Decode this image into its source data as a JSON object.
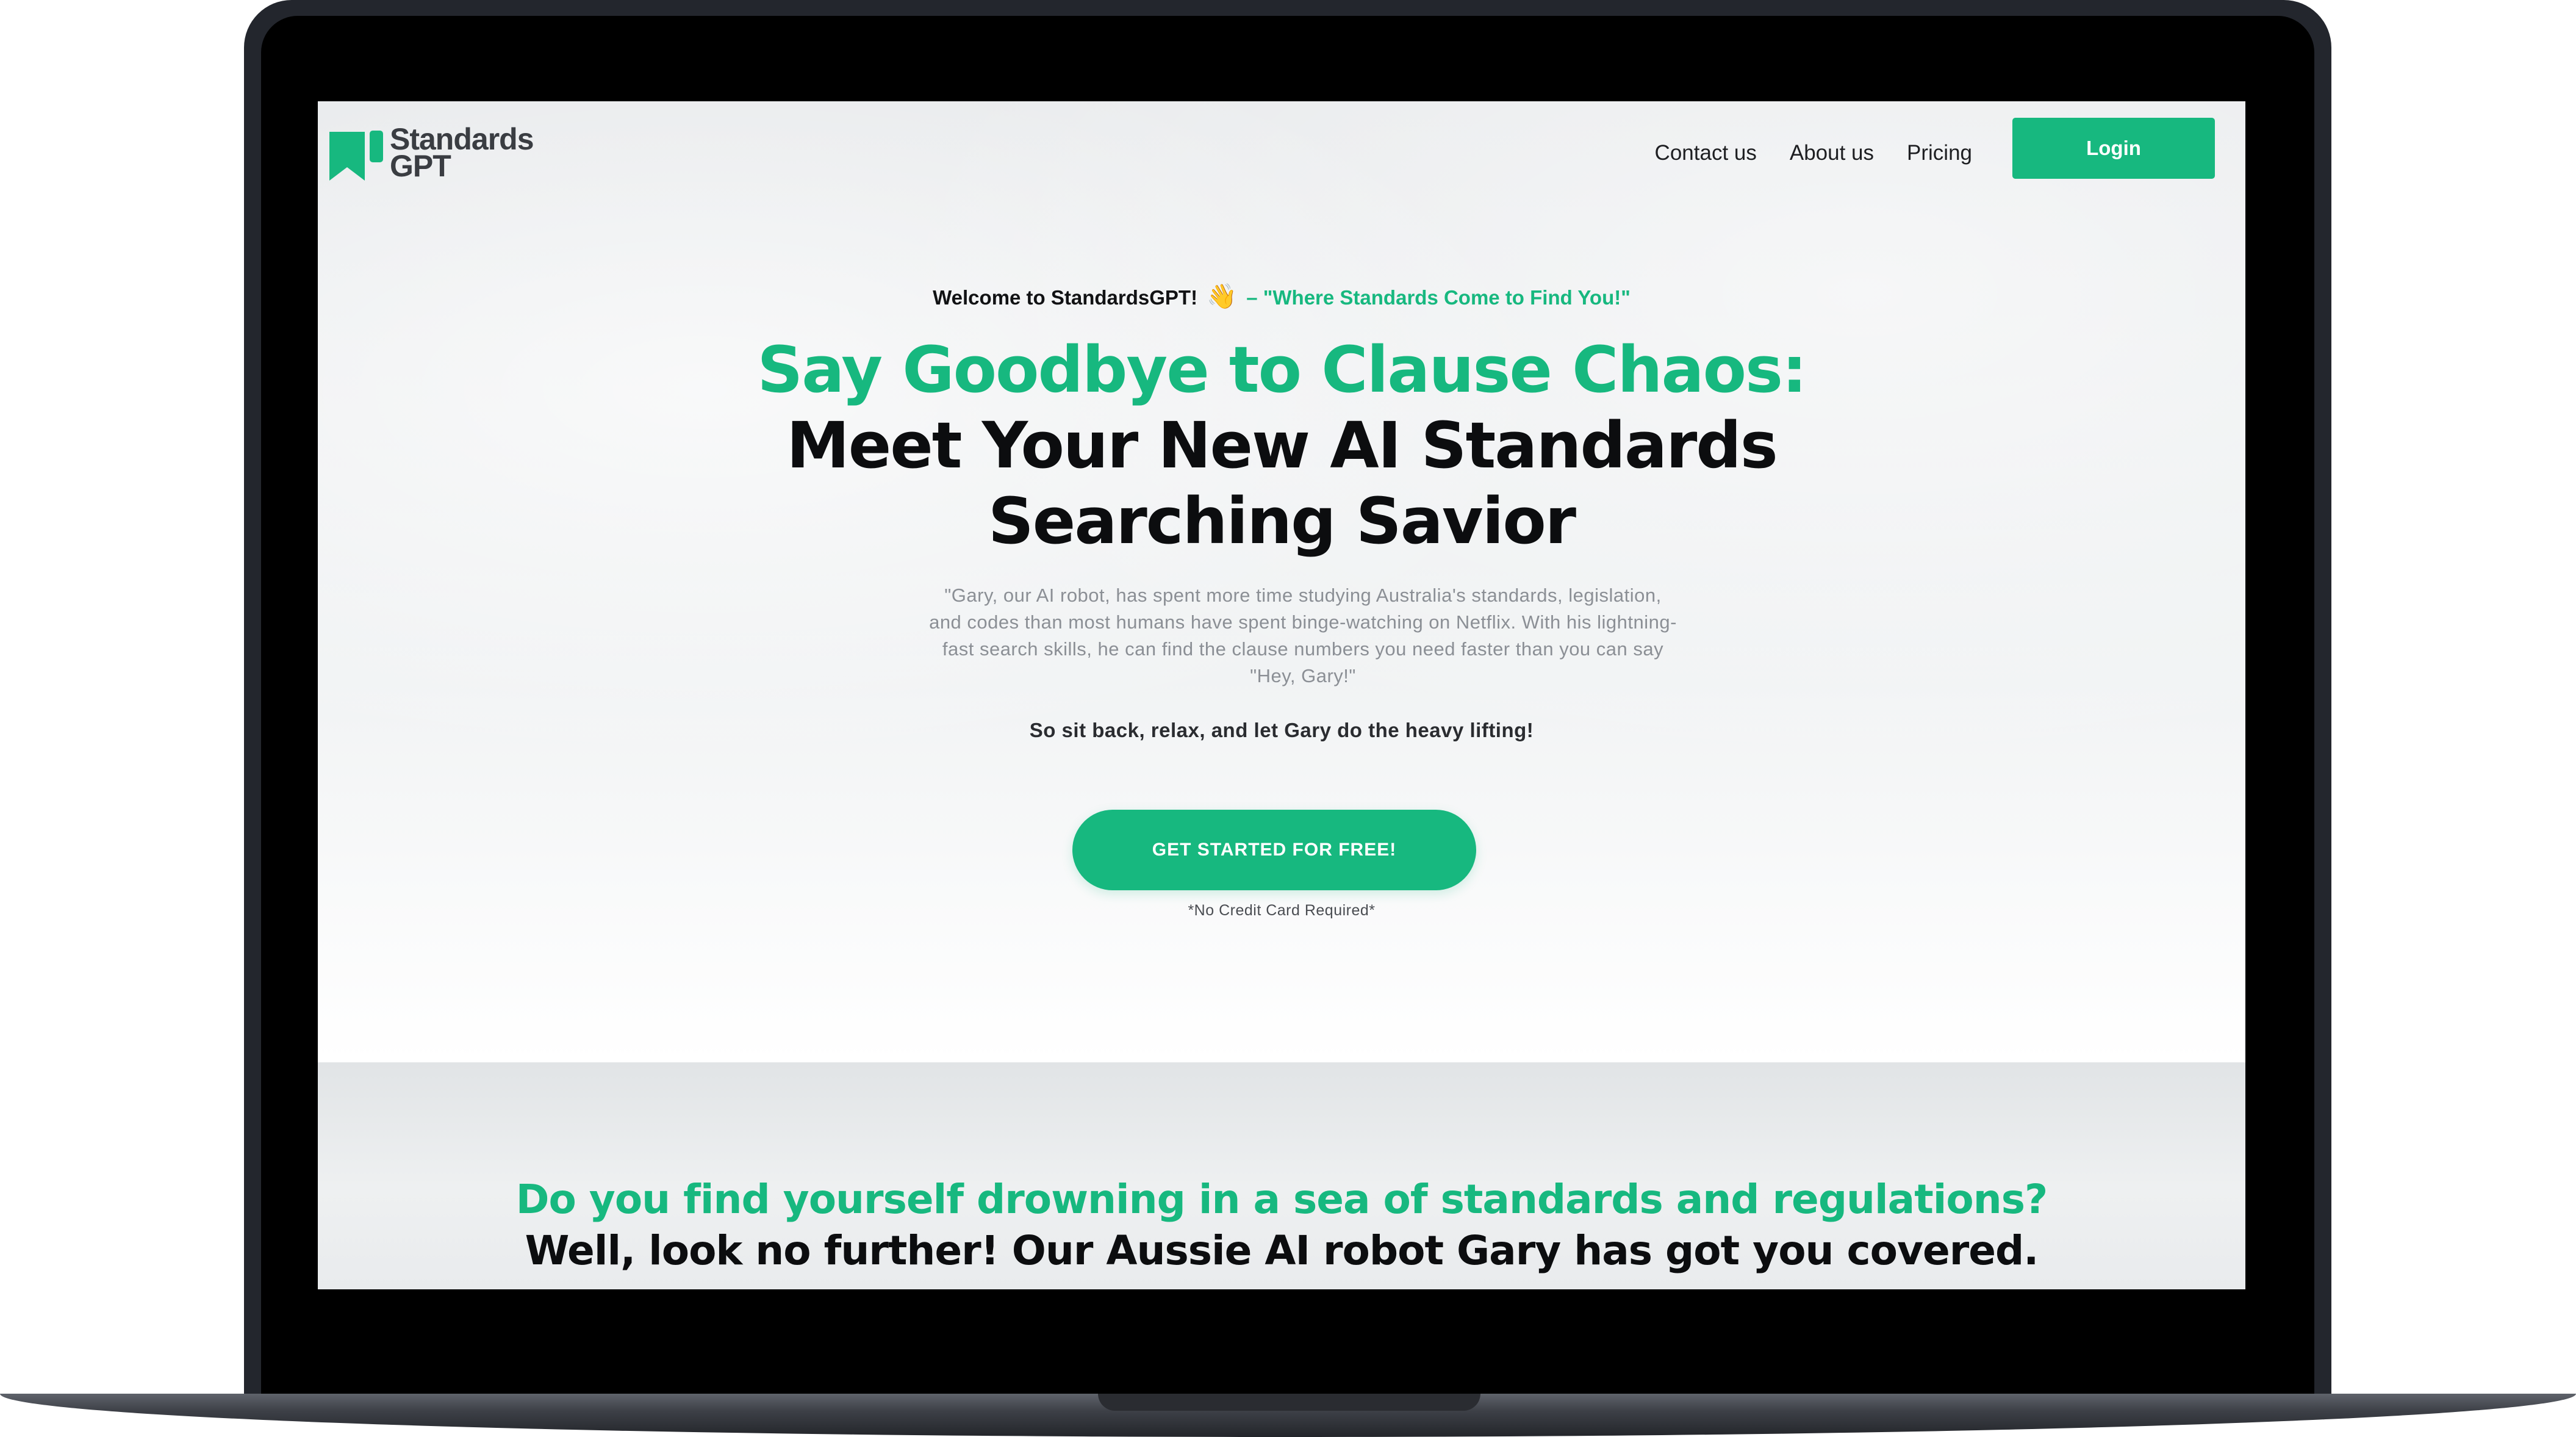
{
  "nav": {
    "logo_text": "Standards GPT",
    "links": [
      "Contact us",
      "About us",
      "Pricing"
    ],
    "login_label": "Login"
  },
  "hero": {
    "welcome": "Welcome to StandardsGPT!",
    "welcome_icon": "👋",
    "welcome_tagline": "– \"Where Standards Come to Find You!\"",
    "headline_green": "Say Goodbye to Clause Chaos:",
    "headline_dark": "Meet Your New AI Standards Searching Savior",
    "quote": "\"Gary, our AI robot, has spent more time studying Australia's standards, legislation, and codes than most humans have spent binge-watching on Netflix. With his lightning-fast search skills, he can find the clause numbers you need faster than you can say \"Hey, Gary!\"",
    "tagline": "So sit back, relax, and let Gary do the heavy lifting!",
    "cta_label": "GET STARTED FOR FREE!",
    "cta_note": "*No Credit Card Required*"
  },
  "section2": {
    "heading_green": "Do you find yourself drowning in a sea of standards and regulations?",
    "heading_dark": "Well, look no further! Our Aussie AI robot Gary has got you covered."
  },
  "colors": {
    "brand_green": "#17b87f",
    "frame": "#23262d",
    "text_dark": "#0c0d0f"
  }
}
